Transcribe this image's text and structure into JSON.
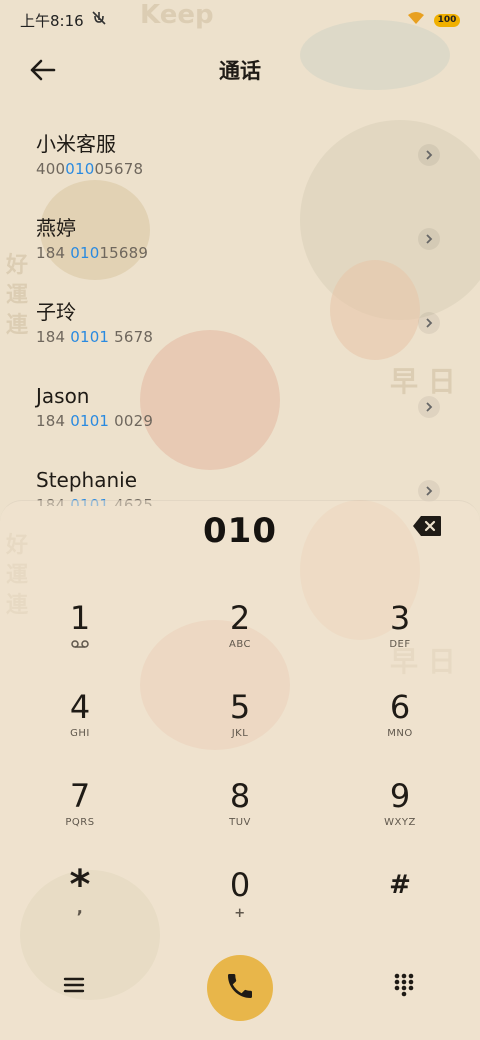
{
  "status_bar": {
    "time": "上午8:16",
    "icons": [
      "mute-icon",
      "wifi-icon",
      "battery-icon"
    ],
    "battery_level": "100"
  },
  "header": {
    "title": "通话",
    "back_icon": "back-arrow-icon"
  },
  "contacts": [
    {
      "name": "小米客服",
      "number_parts": [
        "400",
        "010",
        "05678"
      ]
    },
    {
      "name": "燕婷",
      "number_parts": [
        "184 ",
        "010",
        "15689"
      ]
    },
    {
      "name": "子玲",
      "number_parts": [
        "184 ",
        "0101",
        " 5678"
      ]
    },
    {
      "name": "Jason",
      "number_parts": [
        "184 ",
        "0101",
        " 0029"
      ]
    },
    {
      "name": "Stephanie",
      "number_parts": [
        "184 ",
        "0101",
        " 4625"
      ]
    }
  ],
  "dialer": {
    "entered_number": "010",
    "keys": [
      {
        "digit": "1",
        "sub": "voicemail-icon"
      },
      {
        "digit": "2",
        "sub": "ABC"
      },
      {
        "digit": "3",
        "sub": "DEF"
      },
      {
        "digit": "4",
        "sub": "GHI"
      },
      {
        "digit": "5",
        "sub": "JKL"
      },
      {
        "digit": "6",
        "sub": "MNO"
      },
      {
        "digit": "7",
        "sub": "PQRS"
      },
      {
        "digit": "8",
        "sub": "TUV"
      },
      {
        "digit": "9",
        "sub": "WXYZ"
      },
      {
        "digit": "*",
        "sub": ","
      },
      {
        "digit": "0",
        "sub": "+"
      },
      {
        "digit": "#",
        "sub": ""
      }
    ]
  },
  "bottom_bar": {
    "menu_icon": "menu-icon",
    "call_icon": "phone-icon",
    "keypad_icon": "dialpad-icon"
  },
  "colors": {
    "highlight": "#2a8ae0",
    "call_button": "#e8b64a",
    "background": "#ede1cc"
  }
}
